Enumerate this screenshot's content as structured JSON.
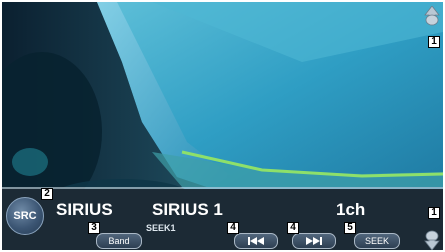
{
  "source_label": "SIRIUS",
  "station_name": "SIRIUS 1",
  "channel": "1ch",
  "seek_mode": "SEEK1",
  "buttons": {
    "src": "SRC",
    "band": "Band",
    "seek": "SEEK",
    "prev_icon": "skip-back-icon",
    "next_icon": "skip-forward-icon"
  },
  "callouts": {
    "n1_top": "1",
    "n1_bottom": "1",
    "n2": "2",
    "n3": "3",
    "n4_prev": "4",
    "n4_next": "4",
    "n5": "5"
  },
  "colors": {
    "sky": "#3fa9c9",
    "bar": "#1c2a35",
    "button": "#3c5674"
  }
}
